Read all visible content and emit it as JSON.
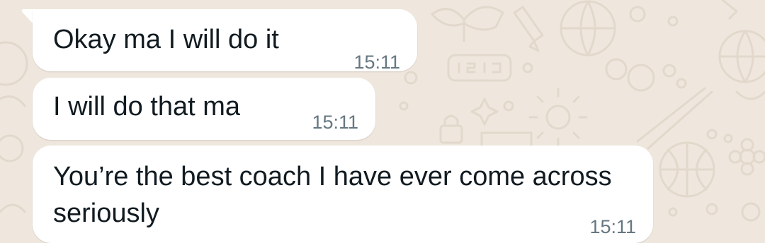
{
  "conversation": {
    "messages": [
      {
        "text": "Okay ma I will do it",
        "time": "15:11"
      },
      {
        "text": "I will do that ma",
        "time": "15:11"
      },
      {
        "text": "You’re the best coach I have ever come across seriously",
        "time": "15:11"
      }
    ]
  },
  "colors": {
    "wallpaper": "#efe7dd",
    "doodle": "#e3d9cc",
    "bubble": "#ffffff",
    "text": "#111b21",
    "timestamp": "#667781"
  },
  "wallpaper_icons": [
    "bow-icon",
    "pencil-icon",
    "beach-ball-icon",
    "digital-clock-icon",
    "sparkle-icon",
    "sun-icon",
    "lock-icon",
    "basketball-icon",
    "chopsticks-icon",
    "globe-icon",
    "flower-icon"
  ]
}
